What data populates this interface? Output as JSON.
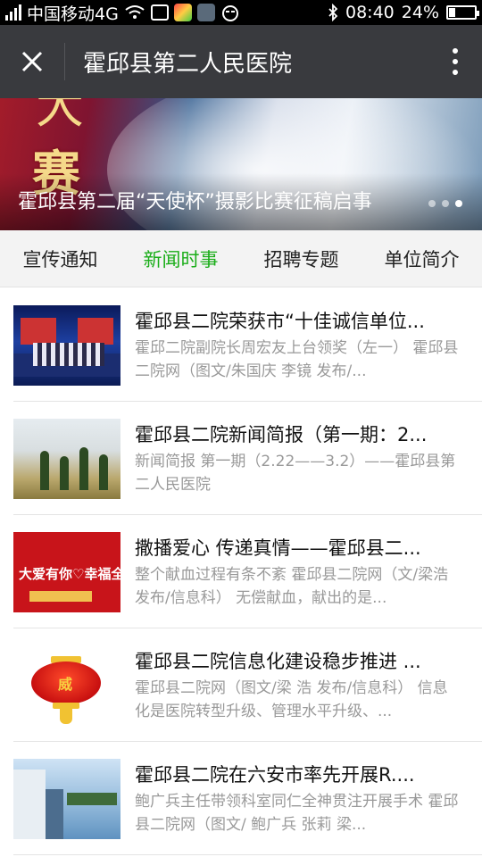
{
  "status_bar": {
    "carrier": "中国移动4G",
    "time": "08:40",
    "battery": "24%",
    "battery_level": 0.24
  },
  "header": {
    "title": "霍邱县第二人民医院"
  },
  "banner": {
    "caption": "霍邱县第二届“天使杯”摄影比赛征稿启事",
    "overlay_chars": [
      "大",
      "赛"
    ],
    "slide_count": 3,
    "active_slide": 3
  },
  "tabs": [
    {
      "label": "宣传通知",
      "active": false
    },
    {
      "label": "新闻时事",
      "active": true
    },
    {
      "label": "招聘专题",
      "active": false
    },
    {
      "label": "单位简介",
      "active": false
    }
  ],
  "colors": {
    "accent": "#1aad19",
    "titlebar": "#393a3e",
    "muted_text": "#999999"
  },
  "articles": [
    {
      "title": "霍邱县二院荣获市“十佳诚信单位...",
      "desc": "霍邱二院副院长周宏友上台领奖（左一） 霍邱县二院网（图文/朱国庆 李镜 发布/..."
    },
    {
      "title": "霍邱县二院新闻简报（第一期：2...",
      "desc": "新闻简报 第一期（2.22——3.2）——霍邱县第二人民医院"
    },
    {
      "title": "撒播爱心 传递真情——霍邱县二...",
      "desc": "整个献血过程有条不紊 霍邱县二院网（文/梁浩 发布/信息科） 无偿献血，献出的是...",
      "thumb_text": "大爱有你♡幸福全城"
    },
    {
      "title": "霍邱县二院信息化建设稳步推进 ...",
      "desc": "霍邱县二院网（图文/梁 浩 发布/信息科） 信息化是医院转型升级、管理水平升级、...",
      "thumb_text": "威"
    },
    {
      "title": "霍邱县二院在六安市率先开展R....",
      "desc": "鲍广兵主任带领科室同仁全神贯注开展手术 霍邱县二院网（图文/ 鲍广兵 张莉 梁..."
    }
  ]
}
